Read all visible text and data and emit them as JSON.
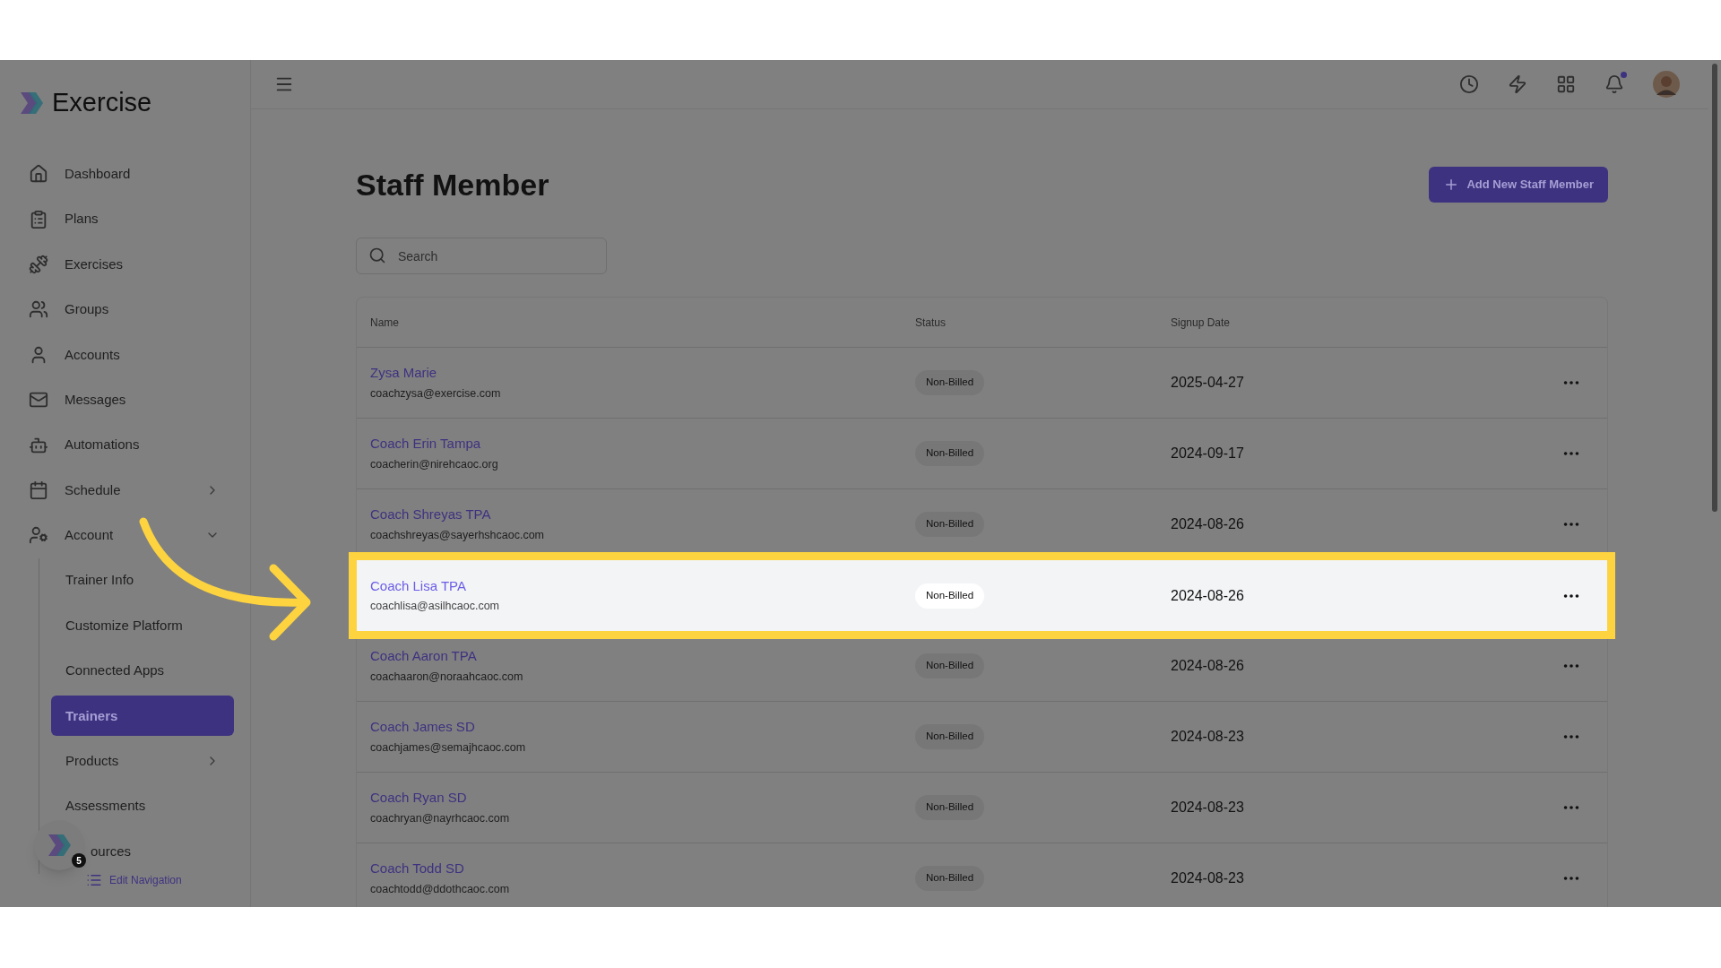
{
  "sidebar": {
    "brand": "Exercise",
    "items": [
      {
        "label": "Dashboard"
      },
      {
        "label": "Plans"
      },
      {
        "label": "Exercises"
      },
      {
        "label": "Groups"
      },
      {
        "label": "Accounts"
      },
      {
        "label": "Messages"
      },
      {
        "label": "Automations"
      },
      {
        "label": "Schedule",
        "expanded": false
      },
      {
        "label": "Account",
        "expanded": true,
        "children": [
          {
            "label": "Trainer Info",
            "selected": false
          },
          {
            "label": "Customize Platform",
            "selected": false
          },
          {
            "label": "Connected Apps",
            "selected": false
          },
          {
            "label": "Trainers",
            "selected": true
          },
          {
            "label": "Products",
            "selected": false,
            "expanded": false
          },
          {
            "label": "Assessments",
            "selected": false
          },
          {
            "label": "ources",
            "selected": false
          }
        ]
      }
    ],
    "widget_badge": "5",
    "edit_link": "Edit Navigation"
  },
  "header": {
    "notification_dot": true
  },
  "page": {
    "title": "Staff Member",
    "add_button": "Add New Staff Member",
    "search": {
      "placeholder": "Search"
    }
  },
  "table": {
    "columns": [
      "Name",
      "Status",
      "Signup Date"
    ],
    "rows": [
      {
        "name": "Zysa Marie",
        "email": "coachzysa@exercise.com",
        "status": "Non-Billed",
        "date": "2025-04-27",
        "highlighted": false
      },
      {
        "name": "Coach Erin Tampa",
        "email": "coacherin@nirehcaoc.org",
        "status": "Non-Billed",
        "date": "2024-09-17",
        "highlighted": false
      },
      {
        "name": "Coach Shreyas TPA",
        "email": "coachshreyas@sayerhshcaoc.com",
        "status": "Non-Billed",
        "date": "2024-08-26",
        "highlighted": false
      },
      {
        "name": "Coach Lisa TPA",
        "email": "coachlisa@asilhcaoc.com",
        "status": "Non-Billed",
        "date": "2024-08-26",
        "highlighted": true
      },
      {
        "name": "Coach Aaron TPA",
        "email": "coachaaron@noraahcaoc.com",
        "status": "Non-Billed",
        "date": "2024-08-26",
        "highlighted": false
      },
      {
        "name": "Coach James SD",
        "email": "coachjames@semajhcaoc.com",
        "status": "Non-Billed",
        "date": "2024-08-23",
        "highlighted": false
      },
      {
        "name": "Coach Ryan SD",
        "email": "coachryan@nayrhcaoc.com",
        "status": "Non-Billed",
        "date": "2024-08-23",
        "highlighted": false
      },
      {
        "name": "Coach Todd SD",
        "email": "coachtodd@ddothcaoc.com",
        "status": "Non-Billed",
        "date": "2024-08-23",
        "highlighted": false
      }
    ]
  }
}
